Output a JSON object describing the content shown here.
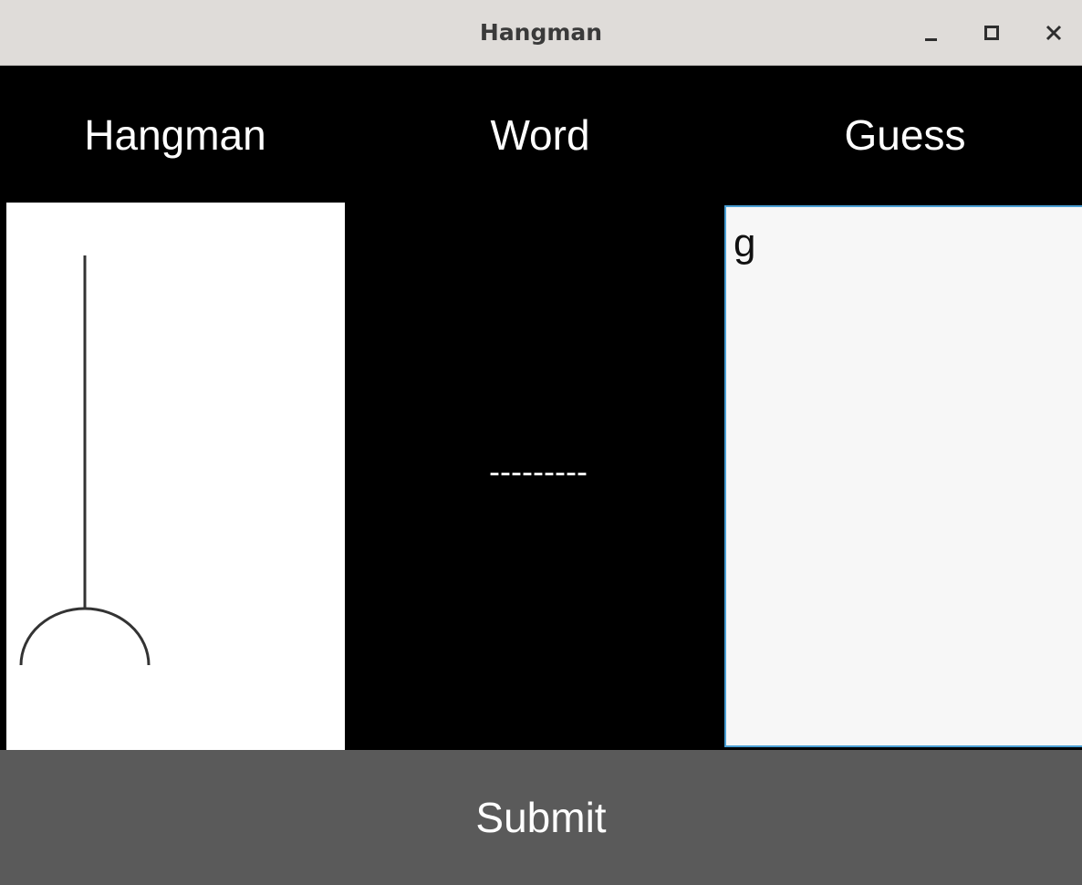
{
  "window": {
    "title": "Hangman",
    "controls": [
      "minimize-icon",
      "maximize-icon",
      "close-icon"
    ]
  },
  "headers": {
    "hangman": "Hangman",
    "word": "Word",
    "guess": "Guess"
  },
  "word_display": "---------",
  "guess_input": {
    "value": "g"
  },
  "submit_label": "Submit",
  "colors": {
    "background": "#000000",
    "titlebar": "#dfdcd9",
    "canvas": "#ffffff",
    "input_background": "#f7f7f7",
    "input_border": "#4a9fd4",
    "submit_background": "#5a5a5a",
    "text_light": "#ffffff"
  }
}
